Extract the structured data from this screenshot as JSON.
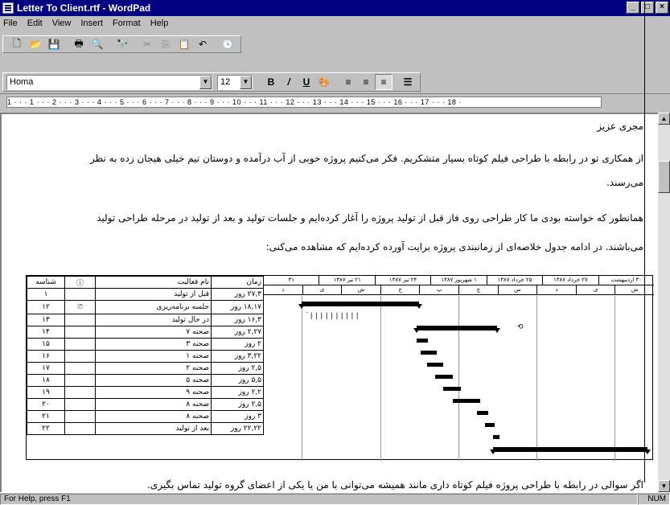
{
  "app": {
    "title": "Letter To Client.rtf - WordPad"
  },
  "window_buttons": [
    "_",
    "□",
    "×"
  ],
  "menu": [
    "File",
    "Edit",
    "View",
    "Insert",
    "Format",
    "Help"
  ],
  "format_bar": {
    "font": "Homa",
    "size": "12",
    "bold": "B",
    "italic": "/",
    "underline": "U",
    "color_icon": "palette-icon"
  },
  "ruler": {
    "text": "1 · · · 1 · · · 2 · · · 3 · · · 4 · · · 5 · · · 6 · · · 7 · · · 8 · · · 9 · · · 10 · · · 11 · · · 12 · · · 13 · · · 14 · · · 15 · · · 16 · · · 17 · · · 18 ·"
  },
  "document": {
    "greeting": "مجری عزیز",
    "para1_line1": "از همکاری تو در رابطه با طراحی فیلم کوتاه بسیار متشکریم. فکر می‌کنیم پروژه خوبی از آب درآمده و دوستان تیم خیلی هیجان زده به نظر",
    "para1_line2": "می‌رسند.",
    "para2_line1": "همانطور که خواسته بودی ما کار طراحی روی فاز قبل از تولید پروژه را آغاز کرده‌ایم و جلسات تولید و بعد از تولید در مرحله طراحی تولید",
    "para2_line2": "می‌باشند. در ادامه جدول خلاصه‌ای از زمانبندی پروژه برایت آورده کرده‌ایم که مشاهده می‌کنی:",
    "closing": "اگر سوالی در رابطه با طراحی پروژه فیلم کوتاه داری مانند همیشه می‌توانی با من یا یکی از اعضای گروه تولید تماس بگیری."
  },
  "gantt": {
    "headers": {
      "id": "شناسه",
      "icon": "ⓘ",
      "name": "نام فعالیت",
      "duration": "زمان"
    },
    "timescale_top": [
      "۳۰ اردیبهشت",
      "۲۷ خرداد ۱۳۸۷",
      "۲۵ خرداد ۱۳۸۷",
      "۱ شهریور ۱۳۸۷",
      "۲۴ تیر ۱۳۸۷",
      "۲۱ تیر ۱۳۸۷",
      "۳۱"
    ],
    "timescale_bottom": [
      "ش",
      "ی",
      "د",
      "س",
      "چ",
      "پ",
      "ج",
      "ش",
      "ی",
      "د"
    ],
    "rows": [
      {
        "id": "۱",
        "icon": "",
        "name": "قبل از تولید",
        "duration": "۲۷,۳ روز"
      },
      {
        "id": "۱۲",
        "icon": "note",
        "name": "جلسه برنامه‌ریزی",
        "duration": "۱۸,۱۷ روز"
      },
      {
        "id": "۱۳",
        "icon": "",
        "name": "در حال تولید",
        "duration": "۱۶,۳ روز"
      },
      {
        "id": "۱۴",
        "icon": "",
        "name": "صحنه ۷",
        "duration": "۲,۲۷ روز"
      },
      {
        "id": "۱۵",
        "icon": "",
        "name": "صحنه ۳",
        "duration": "۲ روز"
      },
      {
        "id": "۱۶",
        "icon": "",
        "name": "صحنه ۱",
        "duration": "۳,۲۲ روز"
      },
      {
        "id": "۱۷",
        "icon": "",
        "name": "صحنه ۲",
        "duration": "۲,۵ روز"
      },
      {
        "id": "۱۸",
        "icon": "",
        "name": "صحنه ۵",
        "duration": "۵,۵ روز"
      },
      {
        "id": "۱۹",
        "icon": "",
        "name": "صحنه ۹",
        "duration": "۲,۲ روز"
      },
      {
        "id": "۲۰",
        "icon": "",
        "name": "صحنه ۸",
        "duration": "۲,۵ روز"
      },
      {
        "id": "۲۱",
        "icon": "",
        "name": "صحنه ۸",
        "duration": "۳ روز"
      },
      {
        "id": "۲۲",
        "icon": "",
        "name": "بعد از تولید",
        "duration": "۲۲,۲۲ روز"
      }
    ]
  },
  "status": {
    "help": "For Help, press F1",
    "mode": "NUM"
  },
  "toolbar_icons": [
    "new-icon",
    "open-icon",
    "save-icon",
    "print-icon",
    "print-preview-icon",
    "find-icon",
    "cut-icon",
    "copy-icon",
    "paste-icon",
    "undo-icon",
    "insert-datetime-icon"
  ],
  "align_icons": [
    "align-left-icon",
    "align-center-icon",
    "align-right-icon",
    "bullets-icon"
  ]
}
